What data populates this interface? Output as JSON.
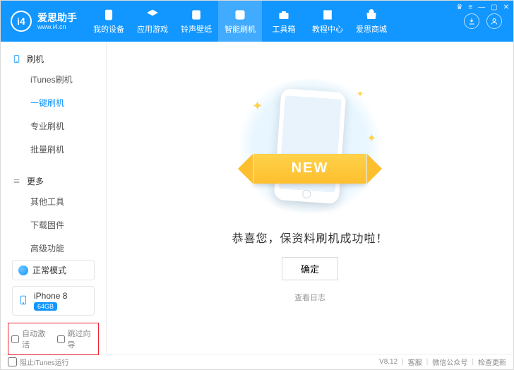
{
  "logo": {
    "mark": "i4",
    "title": "爱思助手",
    "sub": "www.i4.cn"
  },
  "header_tabs": [
    {
      "label": "我的设备",
      "icon": "device"
    },
    {
      "label": "应用游戏",
      "icon": "apps"
    },
    {
      "label": "铃声壁纸",
      "icon": "music"
    },
    {
      "label": "智能刷机",
      "icon": "flash",
      "active": true
    },
    {
      "label": "工具箱",
      "icon": "toolbox"
    },
    {
      "label": "教程中心",
      "icon": "docs"
    },
    {
      "label": "爱思商城",
      "icon": "store"
    }
  ],
  "sidebar": {
    "group1": {
      "title": "刷机",
      "items": [
        {
          "label": "iTunes刷机"
        },
        {
          "label": "一键刷机",
          "active": true
        },
        {
          "label": "专业刷机"
        },
        {
          "label": "批量刷机"
        }
      ]
    },
    "group2": {
      "title": "更多",
      "items": [
        {
          "label": "其他工具"
        },
        {
          "label": "下载固件"
        },
        {
          "label": "高级功能"
        }
      ]
    },
    "mode_label": "正常模式",
    "device_name": "iPhone 8",
    "device_badge": "64GB",
    "options": {
      "auto_activate": "自动激活",
      "skip_guide": "跳过向导"
    }
  },
  "main": {
    "ribbon": "NEW",
    "message": "恭喜您，保资料刷机成功啦！",
    "ok": "确定",
    "view_log": "查看日志"
  },
  "footer": {
    "block_itunes": "阻止iTunes运行",
    "version": "V8.12",
    "service": "客服",
    "wechat": "微信公众号",
    "update": "检查更新"
  }
}
